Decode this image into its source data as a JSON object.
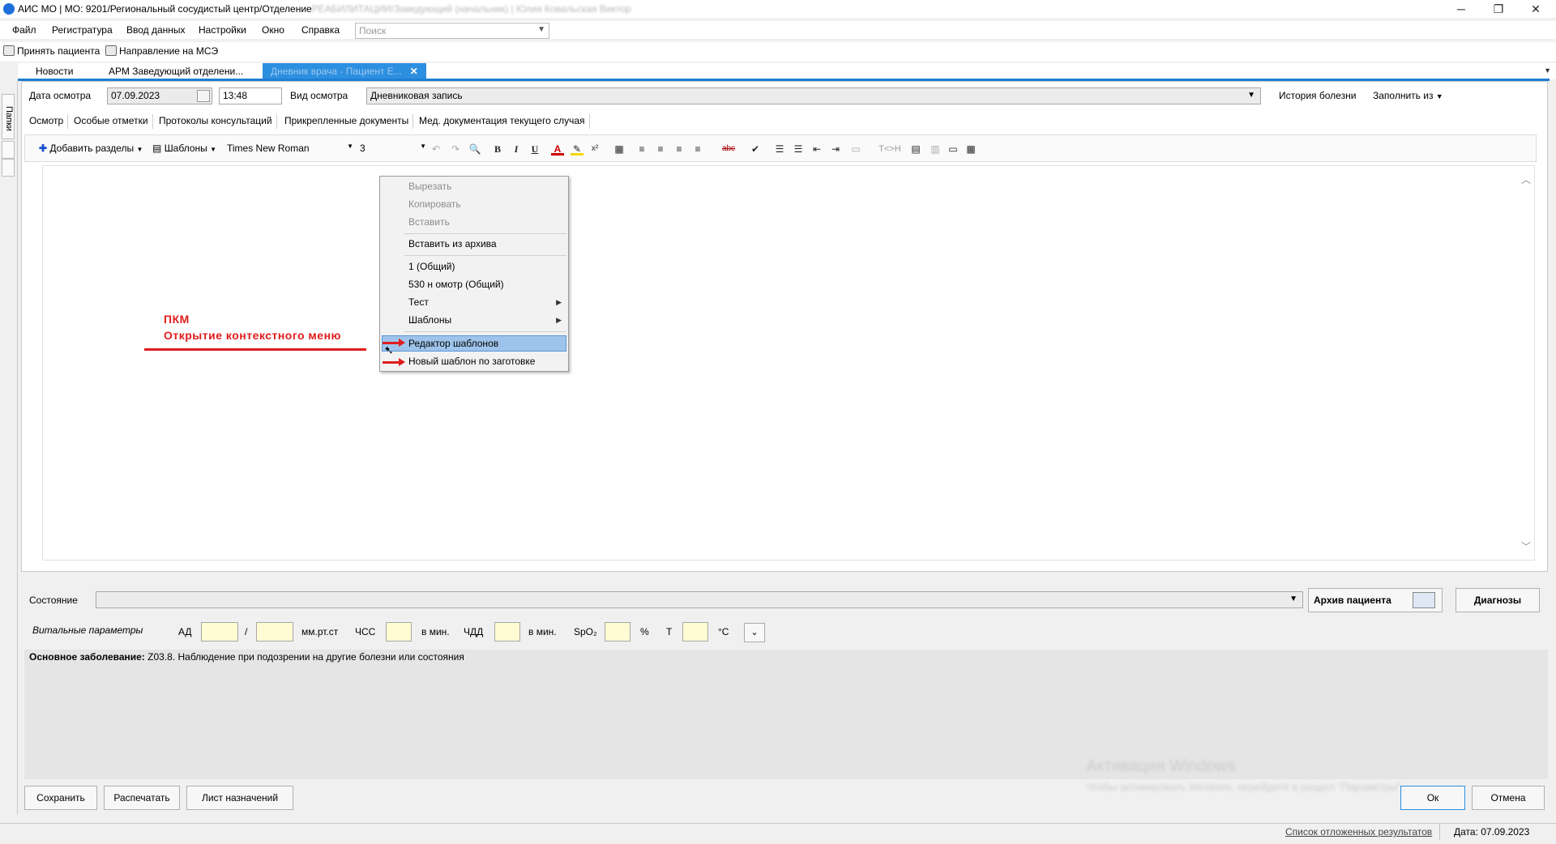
{
  "window": {
    "title_prefix": "АИС МО | МО: 9201/Региональный сосудистый центр/Отделение",
    "title_blurred": "РЕАБИЛИТАЦИИ/Заведующий (начальник) | Юлия Ковальская Виктор",
    "buttons": [
      "─",
      "❐",
      "✕"
    ]
  },
  "menu": {
    "items": [
      "Файл",
      "Регистратура",
      "Ввод данных",
      "Настройки",
      "Окно",
      "Справка"
    ],
    "search_placeholder": "Поиск"
  },
  "toolbar": {
    "accept_patient": "Принять пациента",
    "mse_referral": "Направление на МСЭ"
  },
  "doc_tabs": {
    "news": "Новости",
    "arm": "АРМ Заведующий отделени...",
    "active": "Дневник врача - Пациент Е..."
  },
  "left_strip": {
    "label": "Папки"
  },
  "header": {
    "exam_date_label": "Дата осмотра",
    "exam_date": "07.09.2023",
    "exam_time": "13:48",
    "exam_type_label": "Вид осмотра",
    "exam_type": "Дневниковая  запись",
    "history_link": "История болезни",
    "fill_from": "Заполнить из"
  },
  "sub_tabs": [
    "Осмотр",
    "Особые отметки",
    "Протоколы консультаций",
    "Прикрепленные документы",
    "Мед. документация текущего случая"
  ],
  "editor_toolbar": {
    "add_sections": "Добавить разделы",
    "templates": "Шаблоны",
    "font": "Times New Roman",
    "size": "3",
    "buttons": [
      "↶",
      "↷",
      "🔍",
      "B",
      "I",
      "U",
      "A",
      "✎",
      "x²",
      "▦",
      "≡",
      "≡",
      "≡",
      "≡",
      "abc",
      "✔",
      "☰",
      "☰",
      "⇤",
      "⇥",
      "▭",
      "T<>H",
      "▤",
      "▥",
      "▭",
      "▦"
    ]
  },
  "context_menu": {
    "items": [
      {
        "label": "Вырезать",
        "disabled": true
      },
      {
        "label": "Копировать",
        "disabled": true
      },
      {
        "label": "Вставить",
        "disabled": true
      },
      {
        "label": "Вставить из архива",
        "disabled": false
      },
      {
        "label": "1 (Общий)",
        "disabled": false
      },
      {
        "label": "530 н омотр (Общий)",
        "disabled": false
      },
      {
        "label": "Тест",
        "disabled": false,
        "submenu": true
      },
      {
        "label": "Шаблоны",
        "disabled": false,
        "submenu": true
      },
      {
        "label": "Редактор шаблонов",
        "disabled": false,
        "highlighted": true
      },
      {
        "label": "Новый шаблон по заготовке",
        "disabled": false
      }
    ]
  },
  "annotation": {
    "line1": "ПКМ",
    "line2": "Открытие контекстного меню",
    "color": "#e01d1d"
  },
  "state": {
    "label": "Состояние",
    "archive_button": "Архив пациента",
    "diagnoses_button": "Диагнозы"
  },
  "vitals": {
    "label": "Витальные параметры",
    "ad": "АД",
    "slash": "/",
    "ad_unit": "мм.рт.ст",
    "hr": "ЧСС",
    "hr_unit": "в мин.",
    "rr": "ЧДД",
    "rr_unit": "в мин.",
    "spo2": "SpO₂",
    "spo2_unit": "%",
    "temp": "Т",
    "temp_unit": "°С"
  },
  "diagnosis": {
    "label": "Основное заболевание:",
    "text": " Z03.8. Наблюдение при подозрении на другие болезни или состояния"
  },
  "footer_buttons": {
    "save": "Сохранить",
    "print": "Распечатать",
    "prescriptions": "Лист назначений",
    "ok": "Ок",
    "cancel": "Отмена"
  },
  "watermark": {
    "line1": "Активация Windows",
    "line2": "Чтобы активировать Windows, перейдите в раздел \"Параметры\"."
  },
  "status_bar": {
    "deferred_results": "Список отложенных результатов",
    "date": "Дата: 07.09.2023"
  },
  "colors": {
    "accent_blue": "#1e7fd4",
    "highlight": "#9fc4eb",
    "vital_field": "#fffbd2"
  }
}
